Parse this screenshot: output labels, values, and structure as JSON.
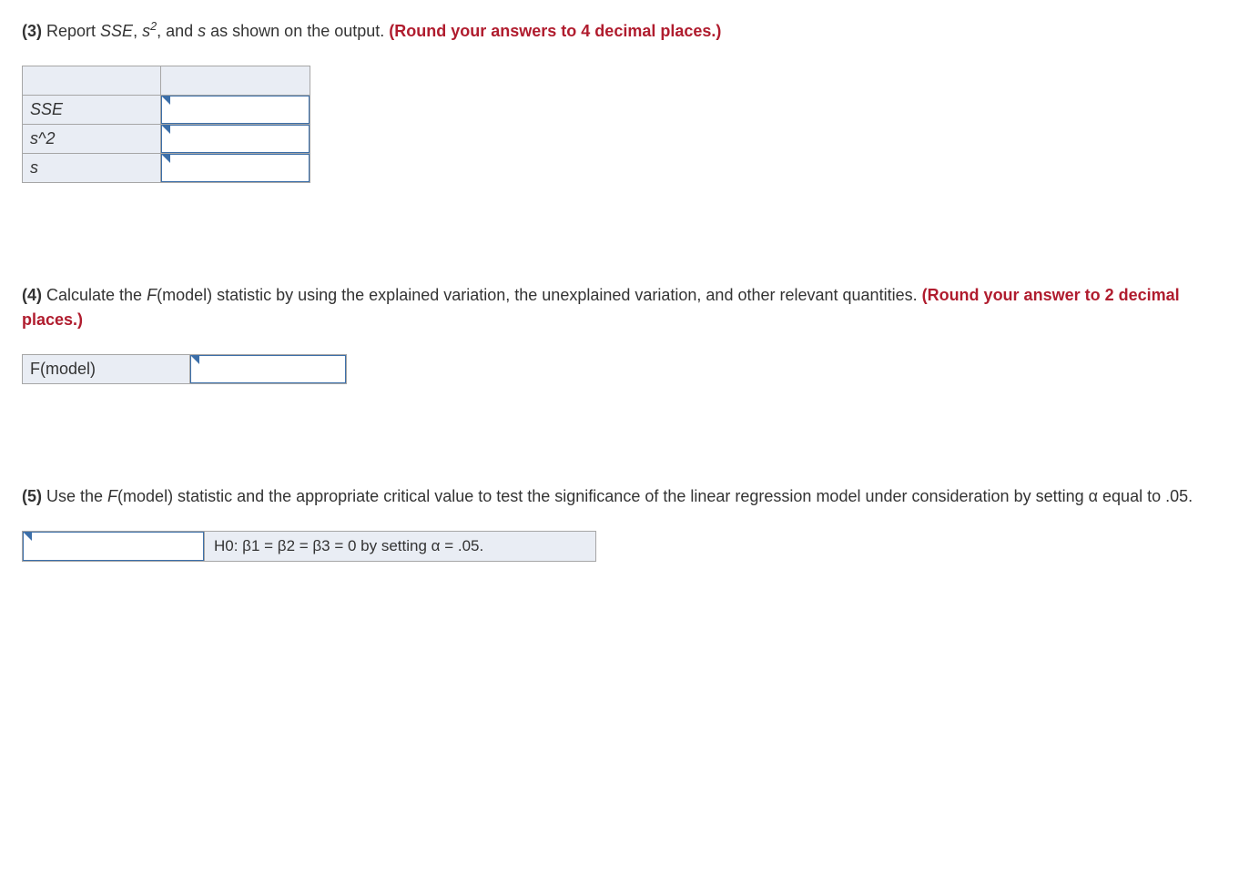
{
  "q3": {
    "num": "(3)",
    "text_a": " Report ",
    "sse": "SSE",
    "comma1": ", ",
    "s": "s",
    "sq": "2",
    "text_b": ", and ",
    "s2": "s",
    "text_c": " as shown on the output. ",
    "hint": "(Round your answers to 4 decimal places.)",
    "rows": {
      "r1": "SSE",
      "r2": "s^2",
      "r3": "s"
    }
  },
  "q4": {
    "num": "(4)",
    "text_a": " Calculate the ",
    "fmodel_f": "F",
    "fmodel_rest": "(model) statistic by using the explained variation, the unexplained variation, and other relevant quantities. ",
    "hint": "(Round your answer to 2 decimal places.)",
    "row_label": "F(model)"
  },
  "q5": {
    "num": "(5)",
    "text_a": "  Use the ",
    "fmodel_f": "F",
    "fmodel_rest": "(model) statistic and the appropriate critical value to test the significance of the linear regression model under consideration by setting ",
    "alpha": "α",
    "text_b": " equal to .05.",
    "hypothesis": "H0: β1 = β2 = β3 = 0 by setting α = .05."
  }
}
